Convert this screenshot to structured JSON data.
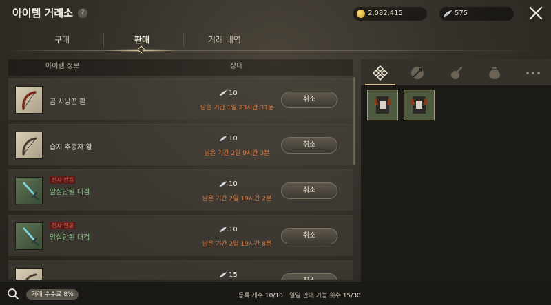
{
  "header": {
    "title": "아이템 거래소",
    "help": "?",
    "gold": "2,082,415",
    "silver": "575"
  },
  "tabs": [
    {
      "label": "구매",
      "active": false
    },
    {
      "label": "판매",
      "active": true
    },
    {
      "label": "거래 내역",
      "active": false
    }
  ],
  "list": {
    "col_item": "아이템 정보",
    "col_status": "상태",
    "rows": [
      {
        "name": "곰 사냥꾼 활",
        "badge": "",
        "price": "10",
        "remaining": "남은 기간 1일 23시간 31분",
        "button": "취소"
      },
      {
        "name": "습지 추종자 활",
        "badge": "",
        "price": "10",
        "remaining": "남은 기간 2일 9시간 3분",
        "button": "취소"
      },
      {
        "name": "암살단원 대검",
        "badge": "전사 전용",
        "price": "10",
        "remaining": "남은 기간 2일 19시간 2분",
        "button": "취소"
      },
      {
        "name": "암살단원 대검",
        "badge": "전사 전용",
        "price": "10",
        "remaining": "남은 기간 2일 19시간 8분",
        "button": "취소"
      },
      {
        "name": "",
        "badge": "",
        "price": "15",
        "remaining": "",
        "button": "취소"
      }
    ]
  },
  "footer": {
    "fee": "거래 수수료 8%",
    "reg_label": "등록 개수",
    "reg_value": "10/10",
    "daily_label": "일일 판매 가능 횟수",
    "daily_value": "15/30"
  },
  "colors": {
    "remaining": "#e07a3c",
    "class_badge_bg": "#5a1d1a",
    "class_badge_text": "#e86a5a",
    "green_name": "#8fc98d"
  }
}
